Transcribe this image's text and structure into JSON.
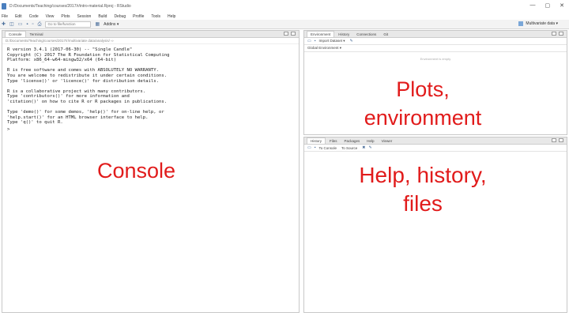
{
  "window": {
    "title": "D:/Documents/Teaching/courses/2017/r/intro-material.Rproj - RStudio",
    "controls": [
      "—",
      "▢",
      "✕"
    ]
  },
  "menu": [
    "File",
    "Edit",
    "Code",
    "View",
    "Plots",
    "Session",
    "Build",
    "Debug",
    "Profile",
    "Tools",
    "Help"
  ],
  "toolbar": {
    "goto_placeholder": "Go to file/function",
    "addins_label": "Addins ▾",
    "project_label": "Multivariate data ▾"
  },
  "left_pane": {
    "tabs": [
      "Console",
      "Terminal"
    ],
    "path": "D:/Documents/Teaching/courses/2017/r/multivariate data/analysis/ ⇨",
    "console_lines": [
      "R version 3.4.1 (2017-06-30) -- \"Single Candle\"",
      "Copyright (C) 2017 The R Foundation for Statistical Computing",
      "Platform: x86_64-w64-mingw32/x64 (64-bit)",
      "",
      "R is free software and comes with ABSOLUTELY NO WARRANTY.",
      "You are welcome to redistribute it under certain conditions.",
      "Type 'license()' or 'licence()' for distribution details.",
      "",
      "R is a collaborative project with many contributors.",
      "Type 'contributors()' for more information and",
      "'citation()' on how to cite R or R packages in publications.",
      "",
      "Type 'demo()' for some demos, 'help()' for on-line help, or",
      "'help.start()' for an HTML browser interface to help.",
      "Type 'q()' to quit R."
    ],
    "prompt": ">"
  },
  "top_right_pane": {
    "tabs": [
      "Environment",
      "History",
      "Connections",
      "Git"
    ],
    "toolbar_items": [
      "Import Dataset ▾"
    ],
    "scope_label": "Global Environment ▾",
    "empty_message": "Environment is empty"
  },
  "bottom_right_pane": {
    "tabs": [
      "History",
      "Files",
      "Packages",
      "Help",
      "Viewer"
    ],
    "toolbar_items": [
      "To Console",
      "To Source"
    ]
  },
  "annotations": {
    "console": "Console",
    "plots_line1": "Plots,",
    "plots_line2": "environment",
    "help_line1": "Help, history,",
    "help_line2": "files"
  },
  "colors": {
    "annotation": "#e11b1b",
    "tab_bar": "#e8e8e8",
    "toolbar": "#f3f3f3"
  }
}
